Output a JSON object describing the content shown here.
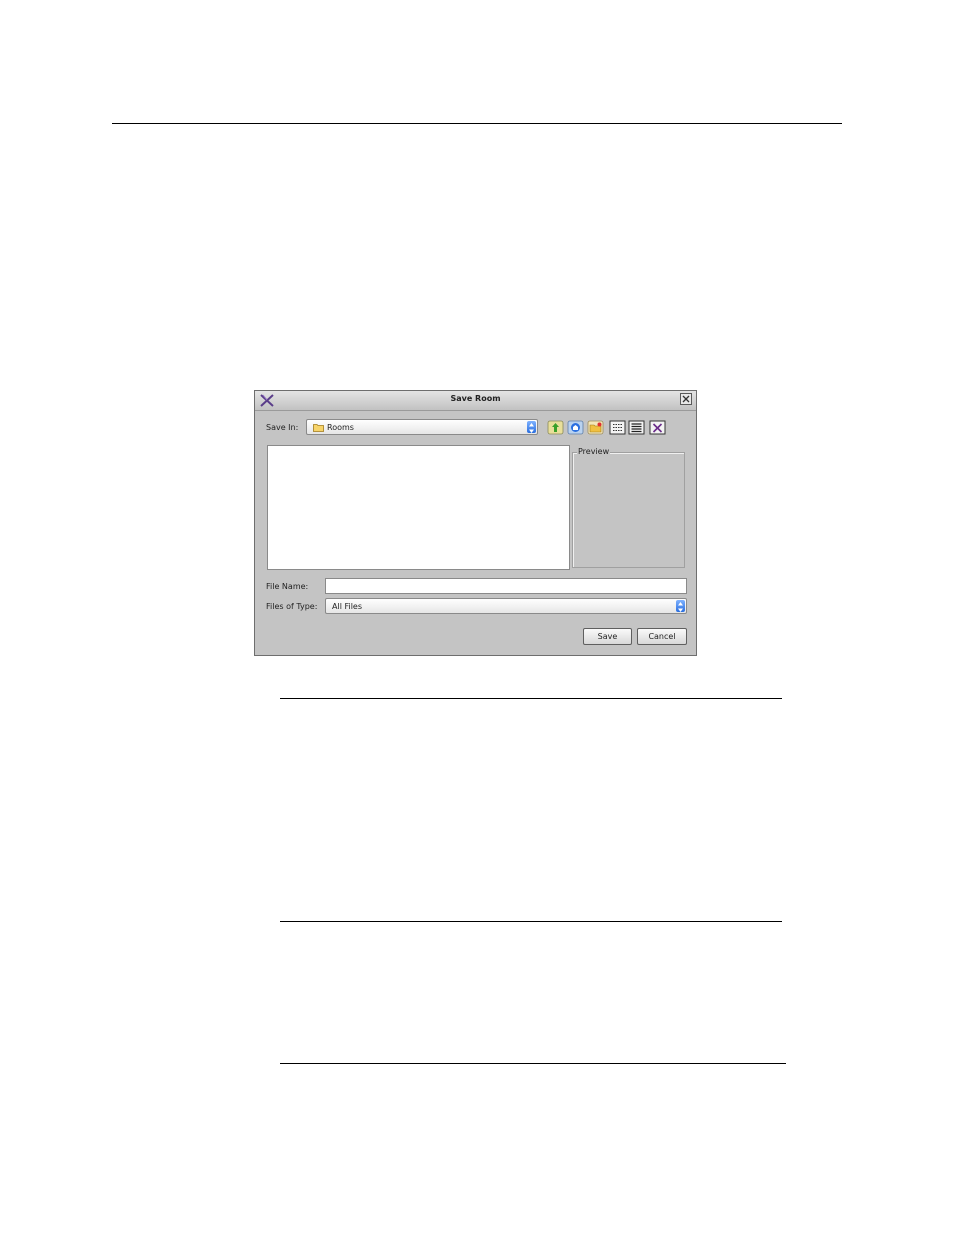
{
  "dialog": {
    "title": "Save Room",
    "save_in_label": "Save In:",
    "save_in_value": "Rooms",
    "preview_label": "Preview",
    "file_name_label": "File Name:",
    "file_name_value": "",
    "files_of_type_label": "Files of Type:",
    "files_of_type_value": "All Files",
    "save_button": "Save",
    "cancel_button": "Cancel"
  },
  "icons": {
    "app": "app-logo-icon",
    "close": "close-icon",
    "folder": "folder-icon",
    "up": "up-folder-icon",
    "home": "home-icon",
    "new_folder": "new-folder-icon",
    "list_view": "list-view-icon",
    "details_view": "details-view-icon",
    "delete": "delete-icon"
  },
  "colors": {
    "dialog_bg": "#c4c4c4",
    "spinner_blue": "#2a6fe0"
  }
}
